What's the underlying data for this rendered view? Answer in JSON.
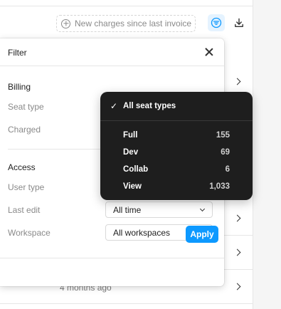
{
  "toolbar": {
    "charges_label": "New charges since last invoice",
    "filter_icon": "filter-icon",
    "download_icon": "download-icon",
    "accent": "#0d99ff"
  },
  "background": {
    "visible_text": "4 months ago"
  },
  "filter_panel": {
    "title": "Filter",
    "billing": {
      "title": "Billing",
      "seat_type_label": "Seat type",
      "charged_label": "Charged"
    },
    "access": {
      "title": "Access",
      "user_type_label": "User type",
      "last_edit_label": "Last edit",
      "last_edit_value": "All time",
      "workspace_label": "Workspace",
      "workspace_value": "All workspaces"
    },
    "apply_label": "Apply"
  },
  "seat_menu": {
    "selected_label": "All seat types",
    "items": [
      {
        "label": "Full",
        "count": "155"
      },
      {
        "label": "Dev",
        "count": "69"
      },
      {
        "label": "Collab",
        "count": "6"
      },
      {
        "label": "View",
        "count": "1,033"
      }
    ]
  }
}
